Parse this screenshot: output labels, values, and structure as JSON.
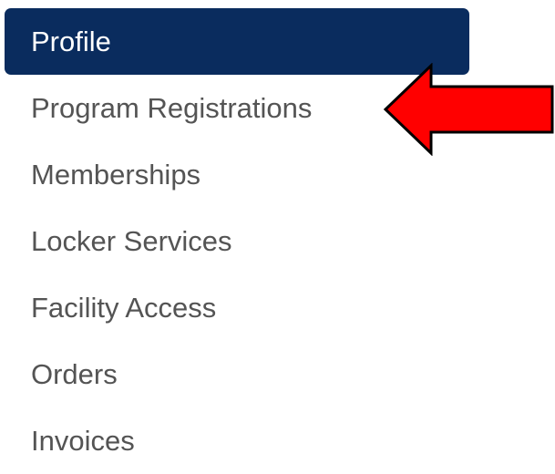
{
  "menu": {
    "items": [
      {
        "label": "Profile",
        "active": true
      },
      {
        "label": "Program Registrations",
        "active": false
      },
      {
        "label": "Memberships",
        "active": false
      },
      {
        "label": "Locker Services",
        "active": false
      },
      {
        "label": "Facility Access",
        "active": false
      },
      {
        "label": "Orders",
        "active": false
      },
      {
        "label": "Invoices",
        "active": false
      }
    ]
  },
  "annotation": {
    "icon": "red-arrow-pointing-left",
    "color": "#ff0000",
    "outline": "#000000"
  },
  "colors": {
    "active_background": "#0a2c5e",
    "active_text": "#ffffff",
    "item_text": "#545454"
  }
}
